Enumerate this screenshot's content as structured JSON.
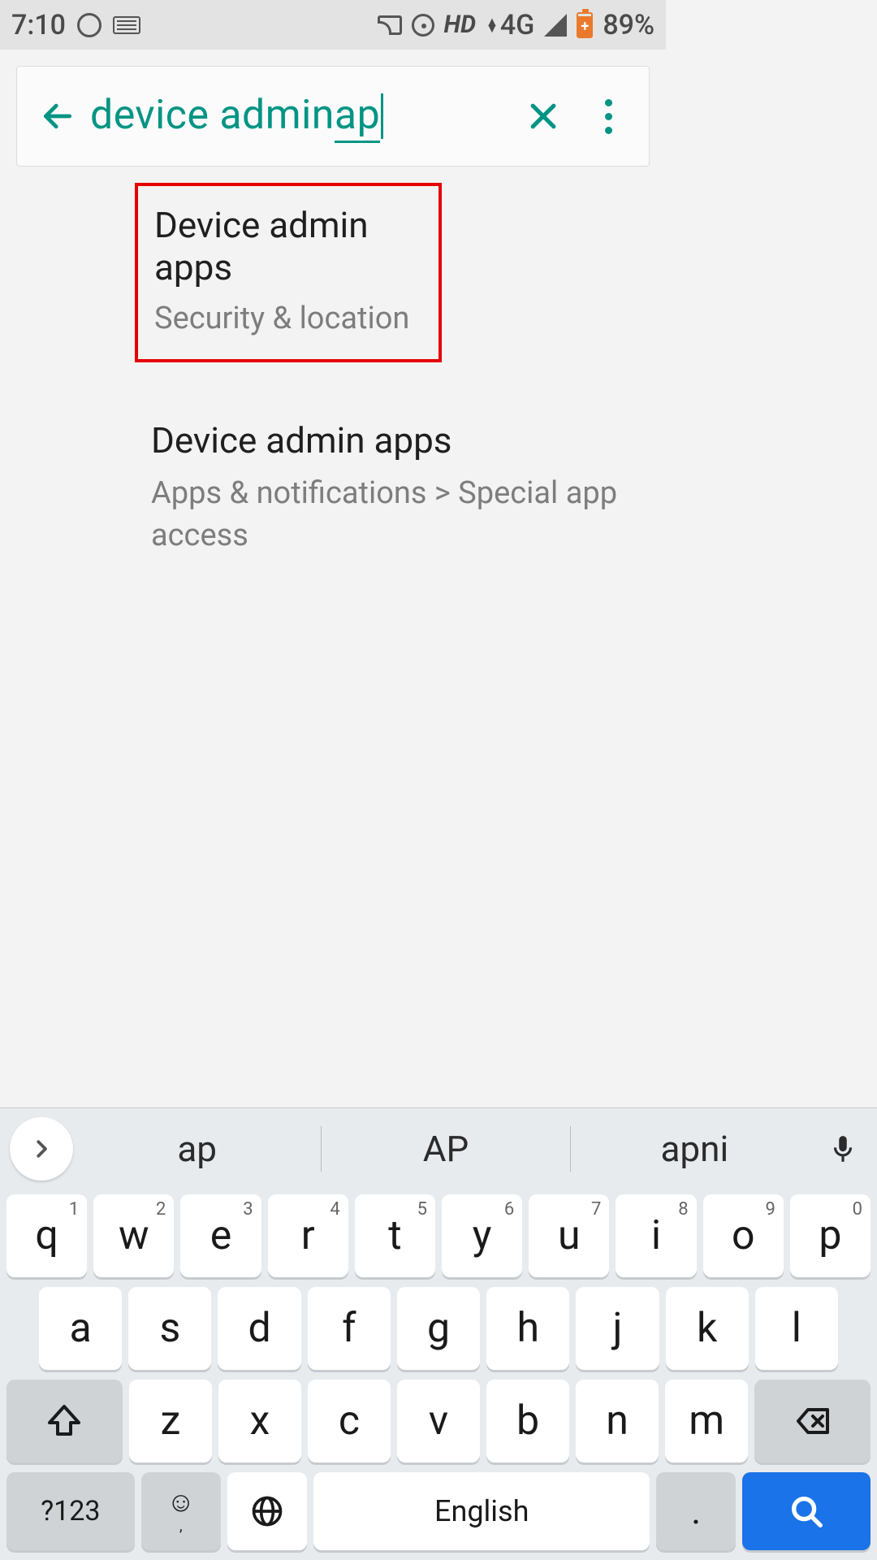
{
  "status": {
    "time": "7:10",
    "hd": "HD",
    "network": "4G",
    "battery_pct": "89%",
    "battery_glyph": "+"
  },
  "search": {
    "prefix": "device admin ",
    "underlined": "ap"
  },
  "results": [
    {
      "title": "Device admin apps",
      "subtitle": "Security & location"
    },
    {
      "title": "Device admin apps",
      "subtitle": "Apps & notifications > Special app access"
    }
  ],
  "keyboard": {
    "suggestions": [
      "ap",
      "AP",
      "apni"
    ],
    "row1": [
      {
        "k": "q",
        "n": "1"
      },
      {
        "k": "w",
        "n": "2"
      },
      {
        "k": "e",
        "n": "3"
      },
      {
        "k": "r",
        "n": "4"
      },
      {
        "k": "t",
        "n": "5"
      },
      {
        "k": "y",
        "n": "6"
      },
      {
        "k": "u",
        "n": "7"
      },
      {
        "k": "i",
        "n": "8"
      },
      {
        "k": "o",
        "n": "9"
      },
      {
        "k": "p",
        "n": "0"
      }
    ],
    "row2": [
      "a",
      "s",
      "d",
      "f",
      "g",
      "h",
      "j",
      "k",
      "l"
    ],
    "row3": [
      "z",
      "x",
      "c",
      "v",
      "b",
      "n",
      "m"
    ],
    "symbols_label": "?123",
    "comma": ",",
    "space_label": "English",
    "period": "."
  }
}
